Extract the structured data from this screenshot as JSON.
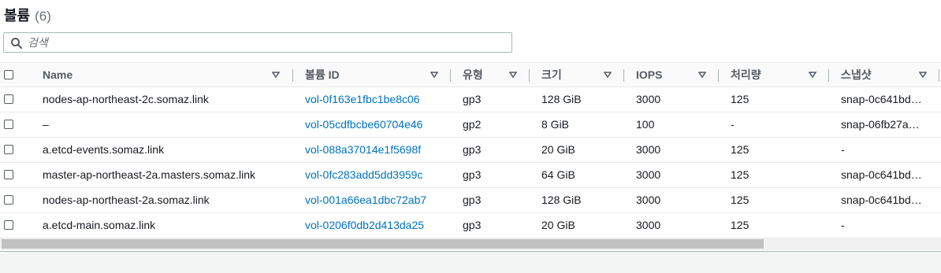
{
  "header": {
    "title": "볼륨",
    "count": "(6)"
  },
  "search": {
    "placeholder": "검색"
  },
  "columns": [
    {
      "label": "Name"
    },
    {
      "label": "볼륨 ID"
    },
    {
      "label": "유형"
    },
    {
      "label": "크기"
    },
    {
      "label": "IOPS"
    },
    {
      "label": "처리량"
    },
    {
      "label": "스냅샷"
    }
  ],
  "rows": [
    {
      "name": "nodes-ap-northeast-2c.somaz.link",
      "volume_id": "vol-0f163e1fbc1be8c06",
      "type": "gp3",
      "size": "128 GiB",
      "iops": "3000",
      "throughput": "125",
      "snapshot": "snap-0c641bd…"
    },
    {
      "name": "–",
      "volume_id": "vol-05cdfbcbe60704e46",
      "type": "gp2",
      "size": "8 GiB",
      "iops": "100",
      "throughput": "-",
      "snapshot": "snap-06fb27a…"
    },
    {
      "name": "a.etcd-events.somaz.link",
      "volume_id": "vol-088a37014e1f5698f",
      "type": "gp3",
      "size": "20 GiB",
      "iops": "3000",
      "throughput": "125",
      "snapshot": "-"
    },
    {
      "name": "master-ap-northeast-2a.masters.somaz.link",
      "volume_id": "vol-0fc283add5dd3959c",
      "type": "gp3",
      "size": "64 GiB",
      "iops": "3000",
      "throughput": "125",
      "snapshot": "snap-0c641bd…"
    },
    {
      "name": "nodes-ap-northeast-2a.somaz.link",
      "volume_id": "vol-001a66ea1dbc72ab7",
      "type": "gp3",
      "size": "128 GiB",
      "iops": "3000",
      "throughput": "125",
      "snapshot": "snap-0c641bd…"
    },
    {
      "name": "a.etcd-main.somaz.link",
      "volume_id": "vol-0206f0db2d413da25",
      "type": "gp3",
      "size": "20 GiB",
      "iops": "3000",
      "throughput": "125",
      "snapshot": "-"
    }
  ],
  "colors": {
    "link": "#0073bb",
    "header_text": "#545b64",
    "border": "#eaeded"
  },
  "icons": {
    "search": "search-icon",
    "sort": "caret-down-icon"
  }
}
